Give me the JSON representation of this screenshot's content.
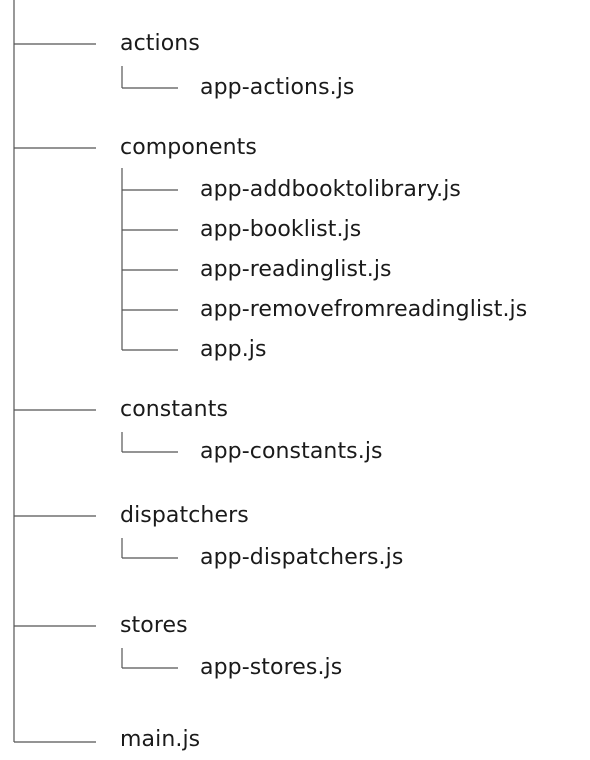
{
  "tree": {
    "folders": [
      {
        "name": "actions",
        "files": [
          "app-actions.js"
        ]
      },
      {
        "name": "components",
        "files": [
          "app-addbooktolibrary.js",
          "app-booklist.js",
          "app-readinglist.js",
          "app-removefromreadinglist.js",
          "app.js"
        ]
      },
      {
        "name": "constants",
        "files": [
          "app-constants.js"
        ]
      },
      {
        "name": "dispatchers",
        "files": [
          "app-dispatchers.js"
        ]
      },
      {
        "name": "stores",
        "files": [
          "app-stores.js"
        ]
      }
    ],
    "root_file": "main.js"
  }
}
